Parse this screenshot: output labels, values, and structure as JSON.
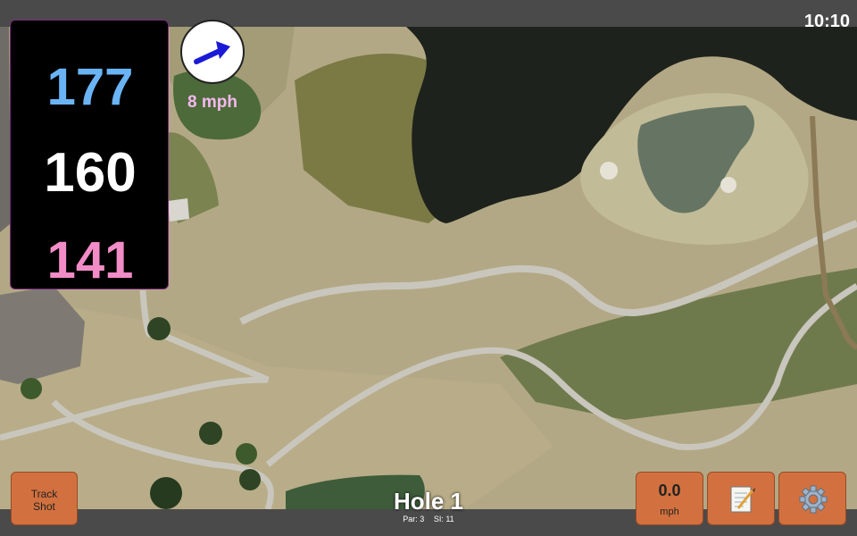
{
  "status": {
    "time": "10:10"
  },
  "distances": {
    "back": "177",
    "middle": "160",
    "front": "141"
  },
  "wind": {
    "label": "8 mph"
  },
  "buttons": {
    "track_line1": "Track",
    "track_line2": "Shot",
    "wind_value": "0.0",
    "wind_unit": "mph"
  },
  "hole": {
    "title": "Hole 1",
    "par": "Par: 3",
    "si": "SI: 11"
  },
  "colors": {
    "back": "#6ab4f5",
    "middle": "#ffffff",
    "front": "#f28cc6",
    "button": "#d2713f",
    "wind_arrow": "#1a1ad6"
  },
  "icons": {
    "wind_arrow": "arrow-icon",
    "notes": "notepad-icon",
    "settings": "gear-icon"
  }
}
